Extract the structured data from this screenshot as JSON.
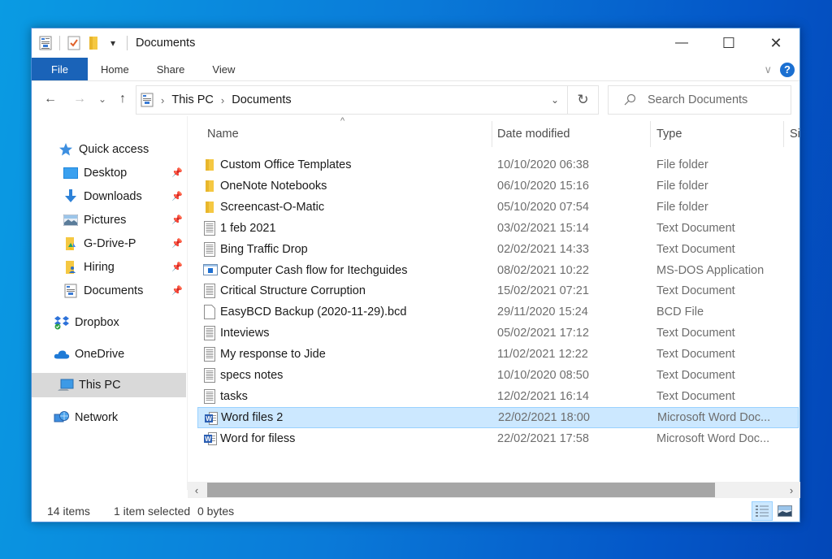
{
  "window": {
    "title": "Documents",
    "controls": {
      "minimize": "—",
      "maximize": "☐",
      "close": "✕"
    }
  },
  "quick_access_toolbar": {
    "items": [
      "properties-icon",
      "new-folder-icon",
      "folder-icon",
      "customize-dropdown"
    ],
    "dropdown_glyph": "▾"
  },
  "ribbon": {
    "tabs": [
      {
        "label": "File",
        "active": true
      },
      {
        "label": "Home"
      },
      {
        "label": "Share"
      },
      {
        "label": "View"
      }
    ],
    "expand_glyph": "∨",
    "help_glyph": "?"
  },
  "navigation": {
    "back": "←",
    "forward": "→",
    "recent": "⌄",
    "up": "↑",
    "breadcrumb": [
      "This PC",
      "Documents"
    ],
    "breadcrumb_separator": "›",
    "address_dropdown": "⌄",
    "refresh": "↻",
    "search_placeholder": "Search Documents"
  },
  "sidebar": {
    "sections": [
      {
        "label": "Quick access",
        "icon": "star-icon"
      },
      {
        "label": "Desktop",
        "icon": "desktop-icon",
        "pinned": true
      },
      {
        "label": "Downloads",
        "icon": "download-icon",
        "pinned": true
      },
      {
        "label": "Pictures",
        "icon": "pictures-icon",
        "pinned": true
      },
      {
        "label": "G-Drive-P",
        "icon": "google-drive-folder-icon",
        "pinned": true
      },
      {
        "label": "Hiring",
        "icon": "user-folder-icon",
        "pinned": true
      },
      {
        "label": "Documents",
        "icon": "documents-icon",
        "pinned": true
      },
      {
        "label": "Dropbox",
        "icon": "dropbox-icon"
      },
      {
        "label": "OneDrive",
        "icon": "onedrive-icon"
      },
      {
        "label": "This PC",
        "icon": "computer-icon",
        "selected": true
      },
      {
        "label": "Network",
        "icon": "network-icon"
      }
    ],
    "pin_glyph": "📌"
  },
  "file_list": {
    "columns": [
      "Name",
      "Date modified",
      "Type",
      "Si"
    ],
    "sort_glyph": "^",
    "rows": [
      {
        "name": "Custom Office Templates",
        "date": "10/10/2020 06:38",
        "type": "File folder",
        "icon": "folder"
      },
      {
        "name": "OneNote Notebooks",
        "date": "06/10/2020 15:16",
        "type": "File folder",
        "icon": "folder"
      },
      {
        "name": "Screencast-O-Matic",
        "date": "05/10/2020 07:54",
        "type": "File folder",
        "icon": "folder"
      },
      {
        "name": "1 feb 2021",
        "date": "03/02/2021 15:14",
        "type": "Text Document",
        "icon": "text"
      },
      {
        "name": "Bing Traffic Drop",
        "date": "02/02/2021 14:33",
        "type": "Text Document",
        "icon": "text"
      },
      {
        "name": "Computer Cash flow for Itechguides",
        "date": "08/02/2021 10:22",
        "type": "MS-DOS Application",
        "icon": "app"
      },
      {
        "name": "Critical Structure Corruption",
        "date": "15/02/2021 07:21",
        "type": "Text Document",
        "icon": "text"
      },
      {
        "name": "EasyBCD Backup (2020-11-29).bcd",
        "date": "29/11/2020 15:24",
        "type": "BCD File",
        "icon": "blank"
      },
      {
        "name": "Inteviews",
        "date": "05/02/2021 17:12",
        "type": "Text Document",
        "icon": "text"
      },
      {
        "name": "My response to Jide",
        "date": "11/02/2021 12:22",
        "type": "Text Document",
        "icon": "text"
      },
      {
        "name": "specs notes",
        "date": "10/10/2020 08:50",
        "type": "Text Document",
        "icon": "text"
      },
      {
        "name": "tasks",
        "date": "12/02/2021 16:14",
        "type": "Text Document",
        "icon": "text"
      },
      {
        "name": "Word files 2",
        "date": "22/02/2021 18:00",
        "type": "Microsoft Word Doc...",
        "icon": "word",
        "selected": true
      },
      {
        "name": "Word for filess",
        "date": "22/02/2021 17:58",
        "type": "Microsoft Word Doc...",
        "icon": "word"
      }
    ]
  },
  "scrollbar": {
    "left": "‹",
    "right": "›",
    "position_fraction": 0.0,
    "visible_fraction": 0.88
  },
  "status_bar": {
    "item_count": "14 items",
    "selection": "1 item selected",
    "size": "0 bytes",
    "views": [
      {
        "name": "details-view",
        "active": true
      },
      {
        "name": "large-icons-view",
        "active": false
      }
    ]
  },
  "colors": {
    "accent": "#1a63b8",
    "selection_bg": "#cce8ff",
    "selection_border": "#99d1ff",
    "sidebar_selected": "#d9d9d9",
    "folder_yellow": "#f5c842"
  }
}
